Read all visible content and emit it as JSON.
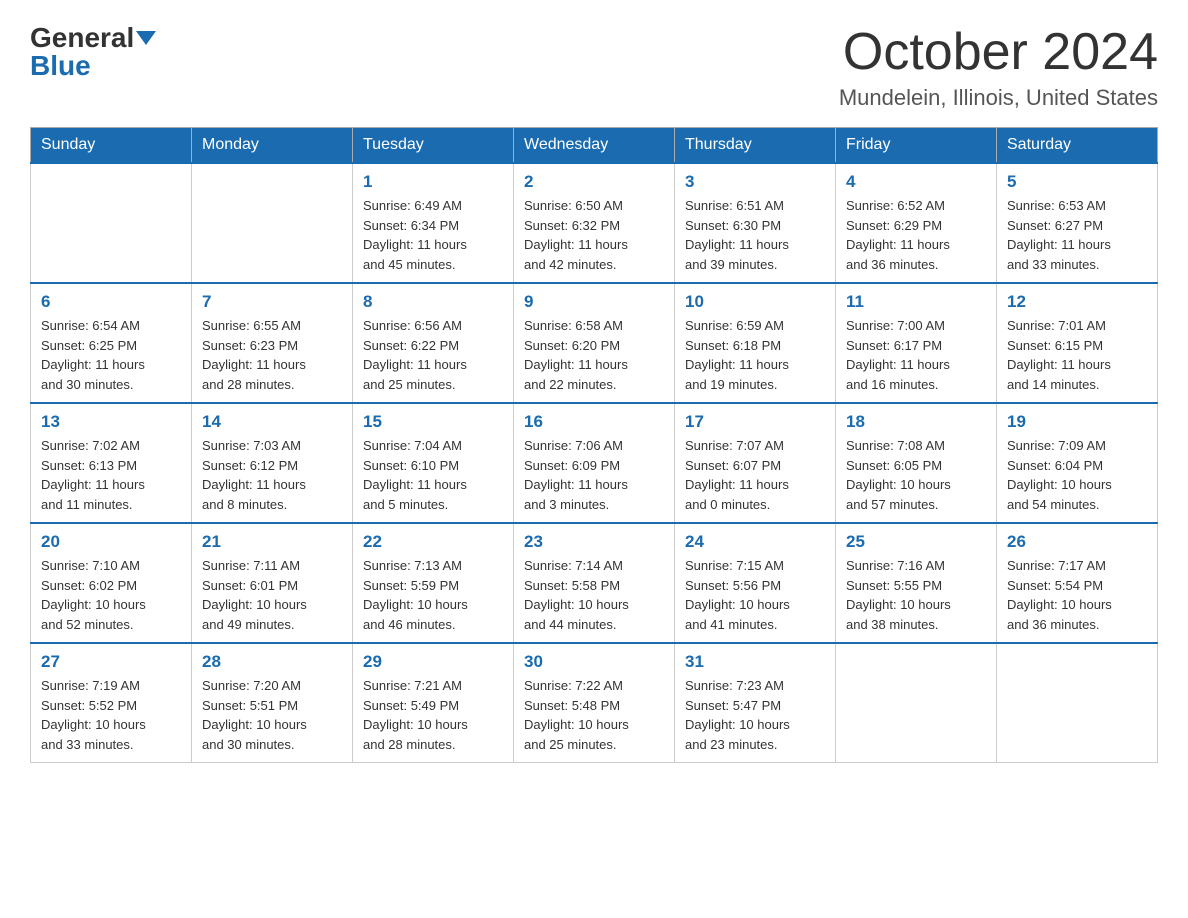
{
  "header": {
    "logo_general": "General",
    "logo_blue": "Blue",
    "month_title": "October 2024",
    "location": "Mundelein, Illinois, United States"
  },
  "days_of_week": [
    "Sunday",
    "Monday",
    "Tuesday",
    "Wednesday",
    "Thursday",
    "Friday",
    "Saturday"
  ],
  "weeks": [
    [
      {
        "day": "",
        "info": ""
      },
      {
        "day": "",
        "info": ""
      },
      {
        "day": "1",
        "info": "Sunrise: 6:49 AM\nSunset: 6:34 PM\nDaylight: 11 hours\nand 45 minutes."
      },
      {
        "day": "2",
        "info": "Sunrise: 6:50 AM\nSunset: 6:32 PM\nDaylight: 11 hours\nand 42 minutes."
      },
      {
        "day": "3",
        "info": "Sunrise: 6:51 AM\nSunset: 6:30 PM\nDaylight: 11 hours\nand 39 minutes."
      },
      {
        "day": "4",
        "info": "Sunrise: 6:52 AM\nSunset: 6:29 PM\nDaylight: 11 hours\nand 36 minutes."
      },
      {
        "day": "5",
        "info": "Sunrise: 6:53 AM\nSunset: 6:27 PM\nDaylight: 11 hours\nand 33 minutes."
      }
    ],
    [
      {
        "day": "6",
        "info": "Sunrise: 6:54 AM\nSunset: 6:25 PM\nDaylight: 11 hours\nand 30 minutes."
      },
      {
        "day": "7",
        "info": "Sunrise: 6:55 AM\nSunset: 6:23 PM\nDaylight: 11 hours\nand 28 minutes."
      },
      {
        "day": "8",
        "info": "Sunrise: 6:56 AM\nSunset: 6:22 PM\nDaylight: 11 hours\nand 25 minutes."
      },
      {
        "day": "9",
        "info": "Sunrise: 6:58 AM\nSunset: 6:20 PM\nDaylight: 11 hours\nand 22 minutes."
      },
      {
        "day": "10",
        "info": "Sunrise: 6:59 AM\nSunset: 6:18 PM\nDaylight: 11 hours\nand 19 minutes."
      },
      {
        "day": "11",
        "info": "Sunrise: 7:00 AM\nSunset: 6:17 PM\nDaylight: 11 hours\nand 16 minutes."
      },
      {
        "day": "12",
        "info": "Sunrise: 7:01 AM\nSunset: 6:15 PM\nDaylight: 11 hours\nand 14 minutes."
      }
    ],
    [
      {
        "day": "13",
        "info": "Sunrise: 7:02 AM\nSunset: 6:13 PM\nDaylight: 11 hours\nand 11 minutes."
      },
      {
        "day": "14",
        "info": "Sunrise: 7:03 AM\nSunset: 6:12 PM\nDaylight: 11 hours\nand 8 minutes."
      },
      {
        "day": "15",
        "info": "Sunrise: 7:04 AM\nSunset: 6:10 PM\nDaylight: 11 hours\nand 5 minutes."
      },
      {
        "day": "16",
        "info": "Sunrise: 7:06 AM\nSunset: 6:09 PM\nDaylight: 11 hours\nand 3 minutes."
      },
      {
        "day": "17",
        "info": "Sunrise: 7:07 AM\nSunset: 6:07 PM\nDaylight: 11 hours\nand 0 minutes."
      },
      {
        "day": "18",
        "info": "Sunrise: 7:08 AM\nSunset: 6:05 PM\nDaylight: 10 hours\nand 57 minutes."
      },
      {
        "day": "19",
        "info": "Sunrise: 7:09 AM\nSunset: 6:04 PM\nDaylight: 10 hours\nand 54 minutes."
      }
    ],
    [
      {
        "day": "20",
        "info": "Sunrise: 7:10 AM\nSunset: 6:02 PM\nDaylight: 10 hours\nand 52 minutes."
      },
      {
        "day": "21",
        "info": "Sunrise: 7:11 AM\nSunset: 6:01 PM\nDaylight: 10 hours\nand 49 minutes."
      },
      {
        "day": "22",
        "info": "Sunrise: 7:13 AM\nSunset: 5:59 PM\nDaylight: 10 hours\nand 46 minutes."
      },
      {
        "day": "23",
        "info": "Sunrise: 7:14 AM\nSunset: 5:58 PM\nDaylight: 10 hours\nand 44 minutes."
      },
      {
        "day": "24",
        "info": "Sunrise: 7:15 AM\nSunset: 5:56 PM\nDaylight: 10 hours\nand 41 minutes."
      },
      {
        "day": "25",
        "info": "Sunrise: 7:16 AM\nSunset: 5:55 PM\nDaylight: 10 hours\nand 38 minutes."
      },
      {
        "day": "26",
        "info": "Sunrise: 7:17 AM\nSunset: 5:54 PM\nDaylight: 10 hours\nand 36 minutes."
      }
    ],
    [
      {
        "day": "27",
        "info": "Sunrise: 7:19 AM\nSunset: 5:52 PM\nDaylight: 10 hours\nand 33 minutes."
      },
      {
        "day": "28",
        "info": "Sunrise: 7:20 AM\nSunset: 5:51 PM\nDaylight: 10 hours\nand 30 minutes."
      },
      {
        "day": "29",
        "info": "Sunrise: 7:21 AM\nSunset: 5:49 PM\nDaylight: 10 hours\nand 28 minutes."
      },
      {
        "day": "30",
        "info": "Sunrise: 7:22 AM\nSunset: 5:48 PM\nDaylight: 10 hours\nand 25 minutes."
      },
      {
        "day": "31",
        "info": "Sunrise: 7:23 AM\nSunset: 5:47 PM\nDaylight: 10 hours\nand 23 minutes."
      },
      {
        "day": "",
        "info": ""
      },
      {
        "day": "",
        "info": ""
      }
    ]
  ]
}
